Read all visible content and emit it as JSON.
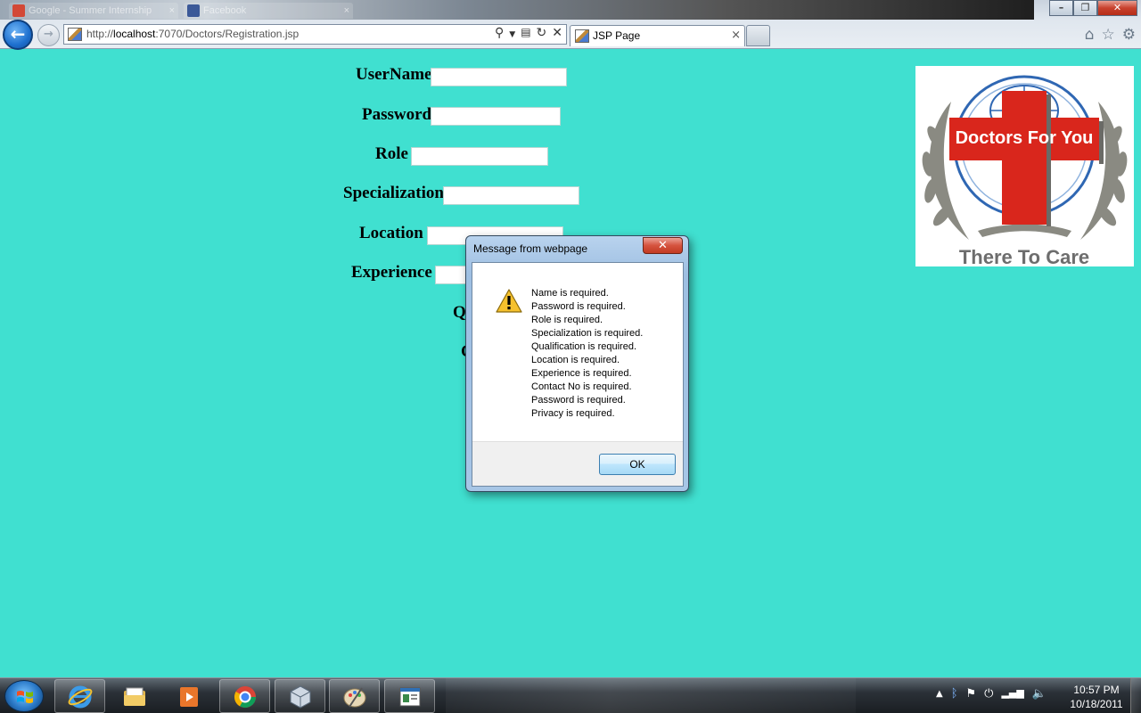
{
  "browser": {
    "background_tabs": [
      "Google - Summer Internship",
      "Facebook"
    ],
    "url_prefix": "http://",
    "url_host": "localhost",
    "url_rest": ":7070/Doctors/Registration.jsp",
    "active_tab_label": "JSP Page",
    "tab_close": "×"
  },
  "form": {
    "labels": {
      "username": "UserName",
      "password": "Password",
      "role": "Role",
      "specialization": "Specialization",
      "location": "Location",
      "experience": "Experience",
      "partial_q": "Q",
      "partial_c": "C"
    },
    "values": {
      "username": "",
      "password": "",
      "role": "",
      "specialization": "",
      "location": "",
      "experience": ""
    }
  },
  "logo": {
    "name": "Doctors For You",
    "tagline": "There To Care",
    "colors": {
      "cross": "#d9261c",
      "globe": "#2f67b3",
      "wreath": "#8a8a82",
      "tagline": "#6d6d6d"
    }
  },
  "dialog": {
    "title": "Message from webpage",
    "close_glyph": "✕",
    "messages": [
      "Name is required.",
      "Password is required.",
      "Role is required.",
      "Specialization is required.",
      "Qualification is required.",
      "Location is required.",
      "Experience is required.",
      "Contact No is required.",
      "Password is required.",
      "Privacy is required."
    ],
    "ok_label": "OK"
  },
  "taskbar": {
    "pinned": [
      "internet-explorer",
      "windows-explorer",
      "media-player",
      "chrome",
      "virtualbox",
      "paint",
      "document-viewer"
    ],
    "clock_time": "10:57 PM",
    "clock_date": "10/18/2011"
  },
  "colors": {
    "page_background": "#40e0d0"
  }
}
